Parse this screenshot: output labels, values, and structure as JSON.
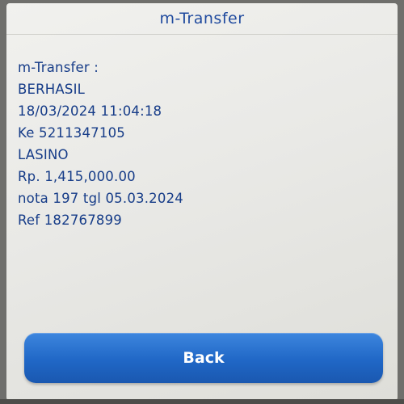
{
  "header": {
    "title": "m-Transfer"
  },
  "details": {
    "heading": "m-Transfer :",
    "status": "BERHASIL",
    "datetime": "18/03/2024 11:04:18",
    "destination": "Ke 5211347105",
    "recipient_name": "LASINO",
    "amount": "Rp. 1,415,000.00",
    "note": "nota 197 tgl 05.03.2024",
    "reference": "Ref 182767899"
  },
  "actions": {
    "back_label": "Back"
  },
  "colors": {
    "text": "#163c88",
    "button": "#2067c6",
    "background": "#ececea"
  }
}
